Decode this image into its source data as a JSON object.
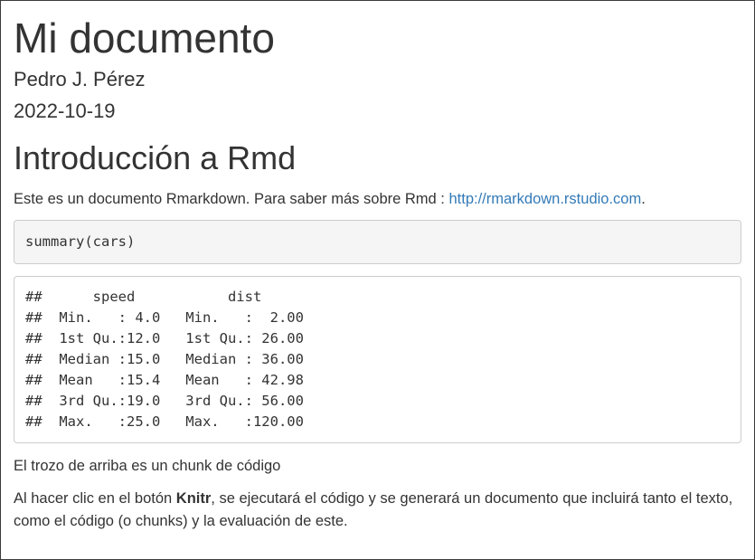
{
  "document": {
    "title": "Mi documento",
    "author": "Pedro J. Pérez",
    "date": "2022-10-19"
  },
  "section": {
    "heading": "Introducción a Rmd",
    "intro_text": "Este es un documento Rmarkdown. Para saber más sobre Rmd : ",
    "intro_link": "http://rmarkdown.rstudio.com",
    "intro_end": "."
  },
  "code_chunk": {
    "source": "summary(cars)",
    "output": "##      speed           dist       \n##  Min.   : 4.0   Min.   :  2.00  \n##  1st Qu.:12.0   1st Qu.: 26.00  \n##  Median :15.0   Median : 36.00  \n##  Mean   :15.4   Mean   : 42.98  \n##  3rd Qu.:19.0   3rd Qu.: 56.00  \n##  Max.   :25.0   Max.   :120.00  "
  },
  "paragraphs": {
    "chunk_note": "El trozo de arriba es un chunk de código",
    "knit_before": "Al hacer clic en el botón ",
    "knit_bold": "Knitr",
    "knit_after": ", se ejecutará el código y se generará un documento que incluirá tanto el texto, como el código (o chunks) y la evaluación de este."
  }
}
